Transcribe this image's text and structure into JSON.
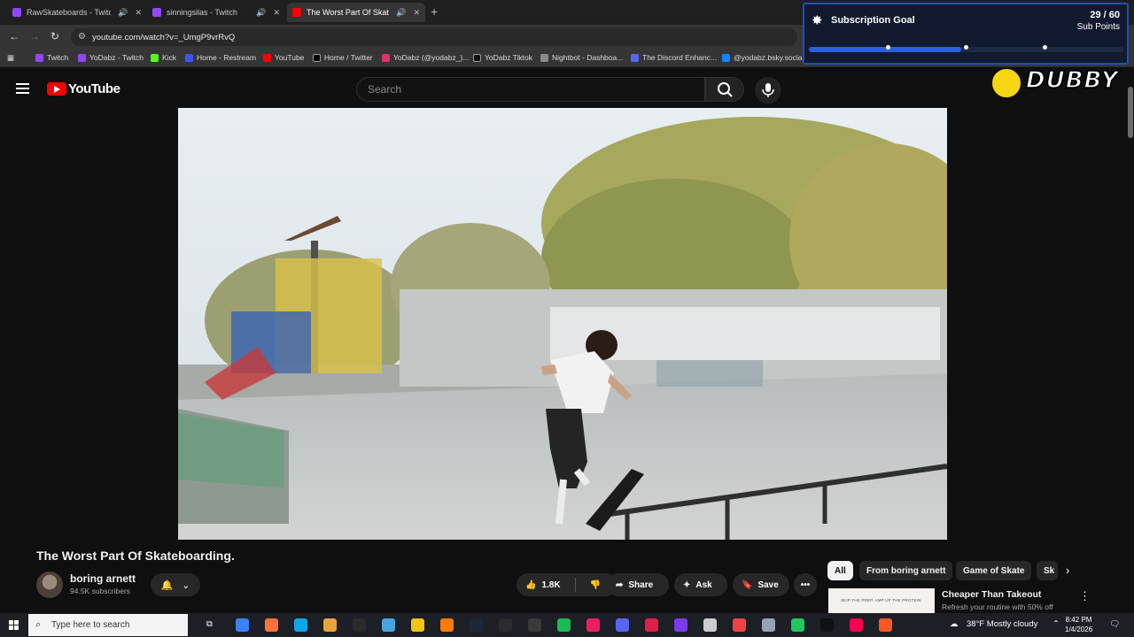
{
  "browser": {
    "tabs": [
      {
        "title": "RawSkateboards - Twitch",
        "active": false,
        "favicon_color": "#9146ff"
      },
      {
        "title": "sinningsilas - Twitch",
        "active": false,
        "favicon_color": "#9146ff"
      },
      {
        "title": "The Worst Part Of Skatebo...",
        "active": true,
        "favicon_color": "#ff0000"
      }
    ],
    "url": "youtube.com/watch?v=_UmgP9vrRvQ",
    "bookmarks": [
      {
        "label": "Twitch",
        "color": "#9146ff"
      },
      {
        "label": "YoDabz - Twitch",
        "color": "#9146ff"
      },
      {
        "label": "Kick",
        "color": "#53fc18"
      },
      {
        "label": "Home - Restream",
        "color": "#3f51ff"
      },
      {
        "label": "YouTube",
        "color": "#ff0000"
      },
      {
        "label": "Home / Twitter",
        "color": "#000000"
      },
      {
        "label": "YoDabz (@yodabz_)...",
        "color": "#e1306c"
      },
      {
        "label": "YoDabz Tiktok",
        "color": "#111111"
      },
      {
        "label": "Nightbot - Dashboa...",
        "color": "#8a8a8a"
      },
      {
        "label": "The Discord Enhanc...",
        "color": "#5865f2"
      },
      {
        "label": "@yodabz.bsky.socia...",
        "color": "#1185fe"
      }
    ]
  },
  "overlay": {
    "goal_title": "Subscription Goal",
    "goal_count": "29 / 60",
    "goal_unit": "Sub Points",
    "goal_progress": 0.4833,
    "brand": "DUBBY"
  },
  "youtube": {
    "logo_text": "YouTube",
    "search_placeholder": "Search",
    "video_title": "The Worst Part Of Skateboarding.",
    "channel_name": "boring arnett",
    "subscribers": "94.5K subscribers",
    "likes": "1.8K",
    "share_label": "Share",
    "ask_label": "Ask",
    "save_label": "Save",
    "chips": [
      "All",
      "From boring arnett",
      "Game of Skate",
      "Sk"
    ],
    "ad": {
      "thumb_text": "SKIP THE PREP. AMP UP THE PROTEIN.",
      "title": "Cheaper Than Takeout",
      "subtitle": "Refresh your routine with 50% off"
    }
  },
  "taskbar": {
    "search_placeholder": "Type here to search",
    "weather": "38°F  Mostly cloudy",
    "time": "8:42 PM",
    "date": "1/4/2026",
    "app_colors": [
      "#3b82f6",
      "#ff7139",
      "#0ea5e9",
      "#e8a33d",
      "#2b2b2b",
      "#4aa3df",
      "#f0c419",
      "#ff7a00",
      "#1b2838",
      "#2b2b2b",
      "#3a3a3a",
      "#1db954",
      "#e91e63",
      "#5865f2",
      "#e11d48",
      "#7c3aed",
      "#cccccc",
      "#ef4444",
      "#94a3b8",
      "#22c55e",
      "#111111",
      "#ff0050",
      "#ff5722"
    ]
  }
}
